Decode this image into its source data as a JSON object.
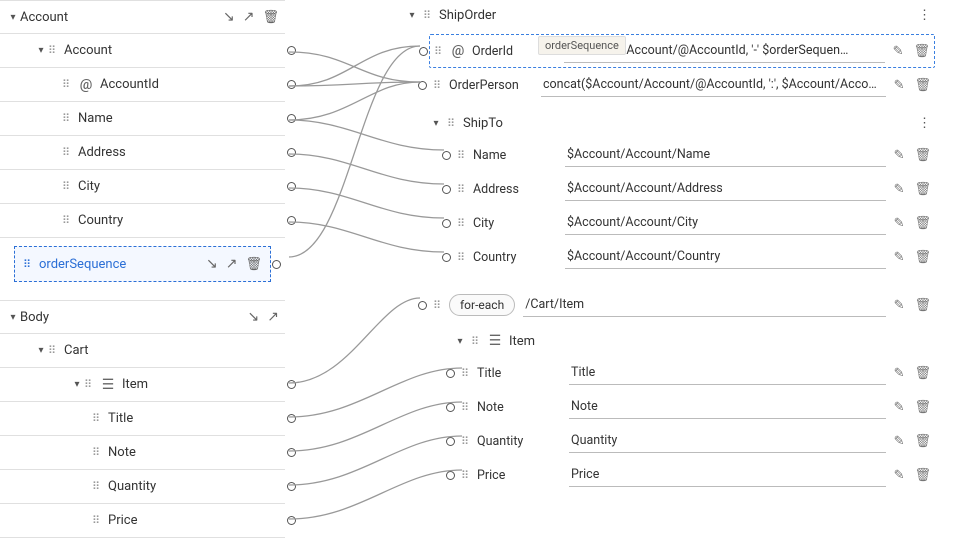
{
  "left": {
    "account": {
      "title": "Account",
      "child": "Account",
      "fields": [
        "AccountId",
        "Name",
        "Address",
        "City",
        "Country"
      ]
    },
    "orderSequence": {
      "label": "orderSequence"
    },
    "body": {
      "title": "Body",
      "cart": "Cart",
      "item": "Item",
      "fields": [
        "Title",
        "Note",
        "Quantity",
        "Price"
      ]
    }
  },
  "right": {
    "shipOrder": "ShipOrder",
    "orderId": {
      "name": "OrderId",
      "value": "concat($Account/Account/Account/@AccountId, '-' $orderSequen…",
      "displayShort": "con               count/Account/@AccountId, '-' $orderSequen…"
    },
    "orderPerson": {
      "name": "OrderPerson",
      "value": "concat($Account/Account/@AccountId, ':', $Account/Account/N…"
    },
    "shipTo": "ShipTo",
    "shipFields": [
      {
        "name": "Name",
        "value": "$Account/Account/Name"
      },
      {
        "name": "Address",
        "value": "$Account/Account/Address"
      },
      {
        "name": "City",
        "value": "$Account/Account/City"
      },
      {
        "name": "Country",
        "value": "$Account/Account/Country"
      }
    ],
    "forEach": {
      "label": "for-each",
      "value": "/Cart/Item"
    },
    "item": "Item",
    "itemFields": [
      {
        "name": "Title",
        "value": "Title"
      },
      {
        "name": "Note",
        "value": "Note"
      },
      {
        "name": "Quantity",
        "value": "Quantity"
      },
      {
        "name": "Price",
        "value": "Price"
      }
    ]
  },
  "tooltip": "orderSequence"
}
